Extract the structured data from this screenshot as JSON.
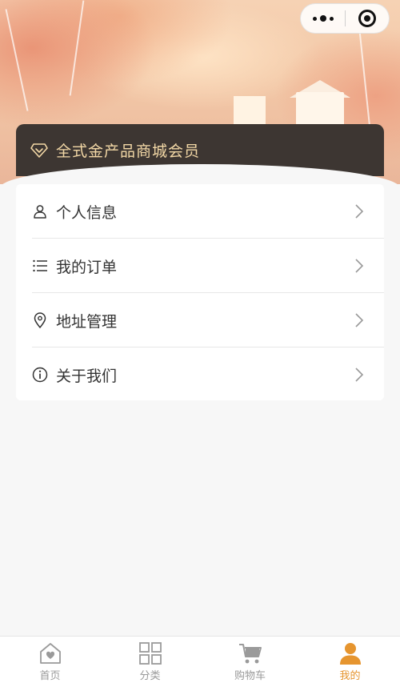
{
  "capsule": {
    "more_icon": "more-dots-icon",
    "close_icon": "target-close-icon"
  },
  "member": {
    "label": "全式金产品商城会员",
    "icon": "diamond-icon",
    "text_color": "#f3d8a6"
  },
  "menu": [
    {
      "label": "个人信息",
      "icon": "person-icon"
    },
    {
      "label": "我的订单",
      "icon": "list-icon"
    },
    {
      "label": "地址管理",
      "icon": "location-pin-icon"
    },
    {
      "label": "关于我们",
      "icon": "info-icon"
    }
  ],
  "tabbar": {
    "items": [
      {
        "label": "首页",
        "icon": "home-heart-icon",
        "active": false
      },
      {
        "label": "分类",
        "icon": "grid-icon",
        "active": false
      },
      {
        "label": "购物车",
        "icon": "cart-icon",
        "active": false
      },
      {
        "label": "我的",
        "icon": "user-icon",
        "active": true
      }
    ],
    "active_color": "#e6952f",
    "inactive_color": "#9a9a9a"
  }
}
